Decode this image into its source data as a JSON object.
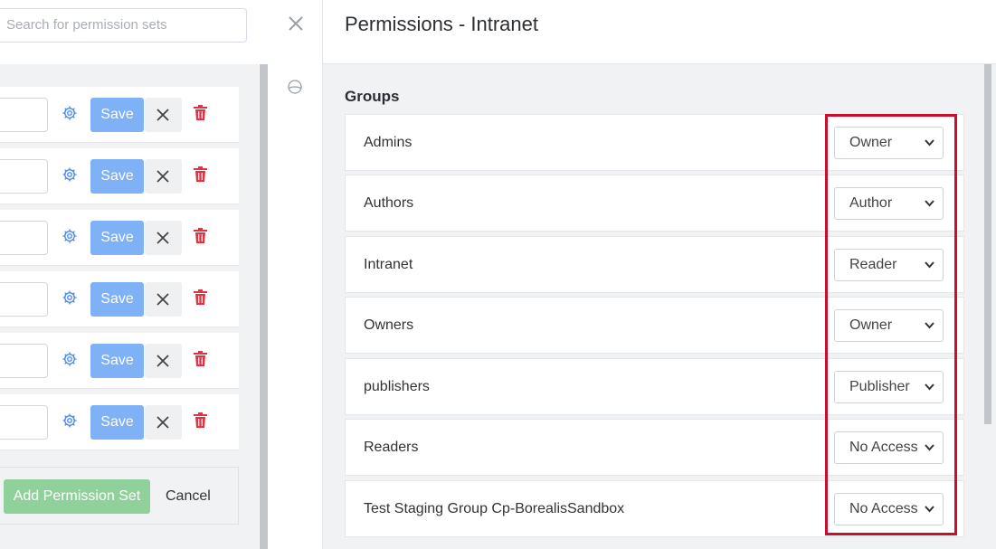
{
  "search": {
    "placeholder": "Search for permission sets"
  },
  "permission_sets": {
    "save_label": "Save",
    "rows": [
      {
        "save": "Save"
      },
      {
        "save": "Save"
      },
      {
        "save": "Save"
      },
      {
        "save": "Save"
      },
      {
        "save": "Save"
      },
      {
        "save": "Save"
      }
    ],
    "add_label": "Add Permission Set",
    "cancel_label": "Cancel"
  },
  "panel": {
    "title": "Permissions - Intranet",
    "groups_heading": "Groups",
    "groups": [
      {
        "name": "Admins",
        "role": "Owner"
      },
      {
        "name": "Authors",
        "role": "Author"
      },
      {
        "name": "Intranet",
        "role": "Reader"
      },
      {
        "name": "Owners",
        "role": "Owner"
      },
      {
        "name": "publishers",
        "role": "Publisher"
      },
      {
        "name": "Readers",
        "role": "No Access"
      },
      {
        "name": "Test Staging Group Cp-BorealisSandbox",
        "role": "No Access"
      }
    ]
  },
  "colors": {
    "save": "#7eb1f5",
    "add": "#8fd09b",
    "delete": "#dc3545",
    "highlight": "#c8102e"
  },
  "icons": [
    "close-icon",
    "gear-icon",
    "trash-icon",
    "x-icon",
    "chevron-down-icon"
  ]
}
